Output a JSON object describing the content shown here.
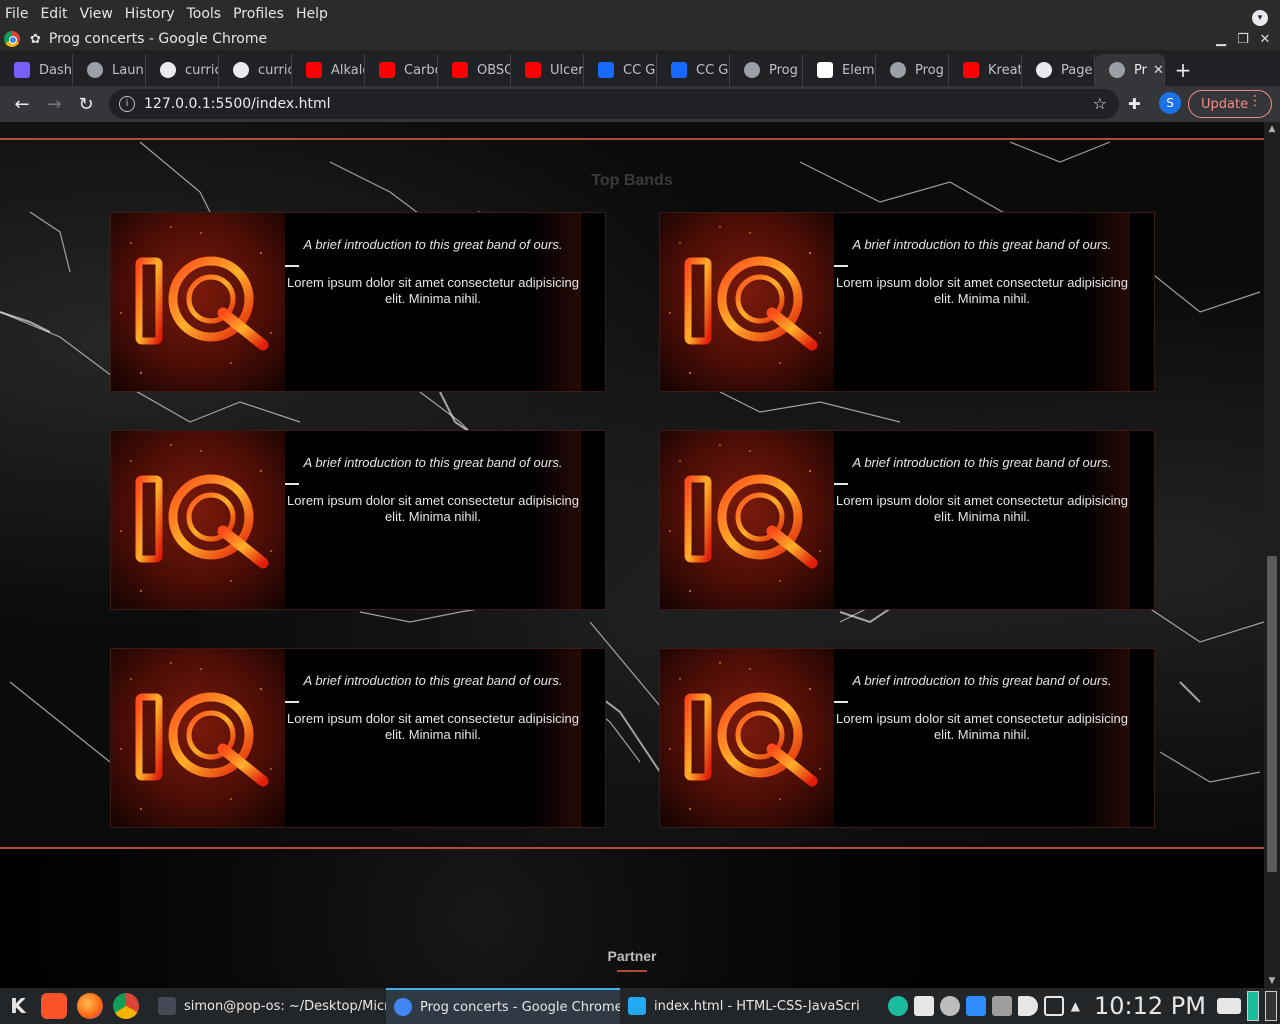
{
  "menubar": {
    "items": [
      "File",
      "Edit",
      "View",
      "History",
      "Tools",
      "Profiles",
      "Help"
    ]
  },
  "window": {
    "title": "Prog concerts - Google Chrome"
  },
  "tabs": [
    {
      "label": "Dash",
      "icon": "monogram-icon",
      "color": "#7b5cff"
    },
    {
      "label": "Laun",
      "icon": "globe-icon",
      "color": "#9aa0a6"
    },
    {
      "label": "curric",
      "icon": "github-icon",
      "color": "#e8eaed"
    },
    {
      "label": "curric",
      "icon": "github-icon",
      "color": "#e8eaed"
    },
    {
      "label": "Alkalo",
      "icon": "youtube-icon",
      "color": "#ff0000"
    },
    {
      "label": "Carbo",
      "icon": "youtube-icon",
      "color": "#ff0000"
    },
    {
      "label": "OBSC",
      "icon": "youtube-icon",
      "color": "#ff0000"
    },
    {
      "label": "Ulcer",
      "icon": "youtube-icon",
      "color": "#ff0000"
    },
    {
      "label": "CC Gl",
      "icon": "behance-icon",
      "color": "#1769ff"
    },
    {
      "label": "CC Gl",
      "icon": "behance-icon",
      "color": "#1769ff"
    },
    {
      "label": "Prog",
      "icon": "globe-icon",
      "color": "#9aa0a6"
    },
    {
      "label": "Elem",
      "icon": "elementor-icon",
      "color": "#ffffff"
    },
    {
      "label": "Prog",
      "icon": "globe-icon",
      "color": "#9aa0a6"
    },
    {
      "label": "Kreat",
      "icon": "youtube-icon",
      "color": "#ff0000"
    },
    {
      "label": "Page",
      "icon": "github-icon",
      "color": "#e8eaed"
    }
  ],
  "active_tab": {
    "label": "Pr",
    "close": "✕"
  },
  "new_tab_label": "+",
  "toolbar": {
    "url": "127.0.0.1:5500/index.html",
    "update_label": "Update",
    "avatar_letter": "S"
  },
  "page": {
    "section_title": "Top Bands",
    "cards": [
      {
        "intro": "A brief introduction to this great band of ours.",
        "desc": "Lorem ipsum dolor sit amet consectetur adipisicing elit. Minima nihil.",
        "logo": "IQ"
      },
      {
        "intro": "A brief introduction to this great band of ours.",
        "desc": "Lorem ipsum dolor sit amet consectetur adipisicing elit. Minima nihil.",
        "logo": "IQ"
      },
      {
        "intro": "A brief introduction to this great band of ours.",
        "desc": "Lorem ipsum dolor sit amet consectetur adipisicing elit. Minima nihil.",
        "logo": "IQ"
      },
      {
        "intro": "A brief introduction to this great band of ours.",
        "desc": "Lorem ipsum dolor sit amet consectetur adipisicing elit. Minima nihil.",
        "logo": "IQ"
      },
      {
        "intro": "A brief introduction to this great band of ours.",
        "desc": "Lorem ipsum dolor sit amet consectetur adipisicing elit. Minima nihil.",
        "logo": "IQ"
      },
      {
        "intro": "A brief introduction to this great band of ours.",
        "desc": "Lorem ipsum dolor sit amet consectetur adipisicing elit. Minima nihil.",
        "logo": "IQ"
      }
    ],
    "partner_heading": "Partner",
    "accent": "#b54a3a"
  },
  "taskbar": {
    "tasks": [
      {
        "label": "simon@pop-os: ~/Desktop/Micr...",
        "icon": "terminal-icon",
        "color": "#444a55"
      },
      {
        "label": "Prog concerts - Google Chrome",
        "icon": "chrome-icon",
        "color": "#4285f4"
      },
      {
        "label": "index.html - HTML-CSS-JavaScri...",
        "icon": "vscode-icon",
        "color": "#23a9f2"
      }
    ],
    "clock": "10:12 PM"
  }
}
